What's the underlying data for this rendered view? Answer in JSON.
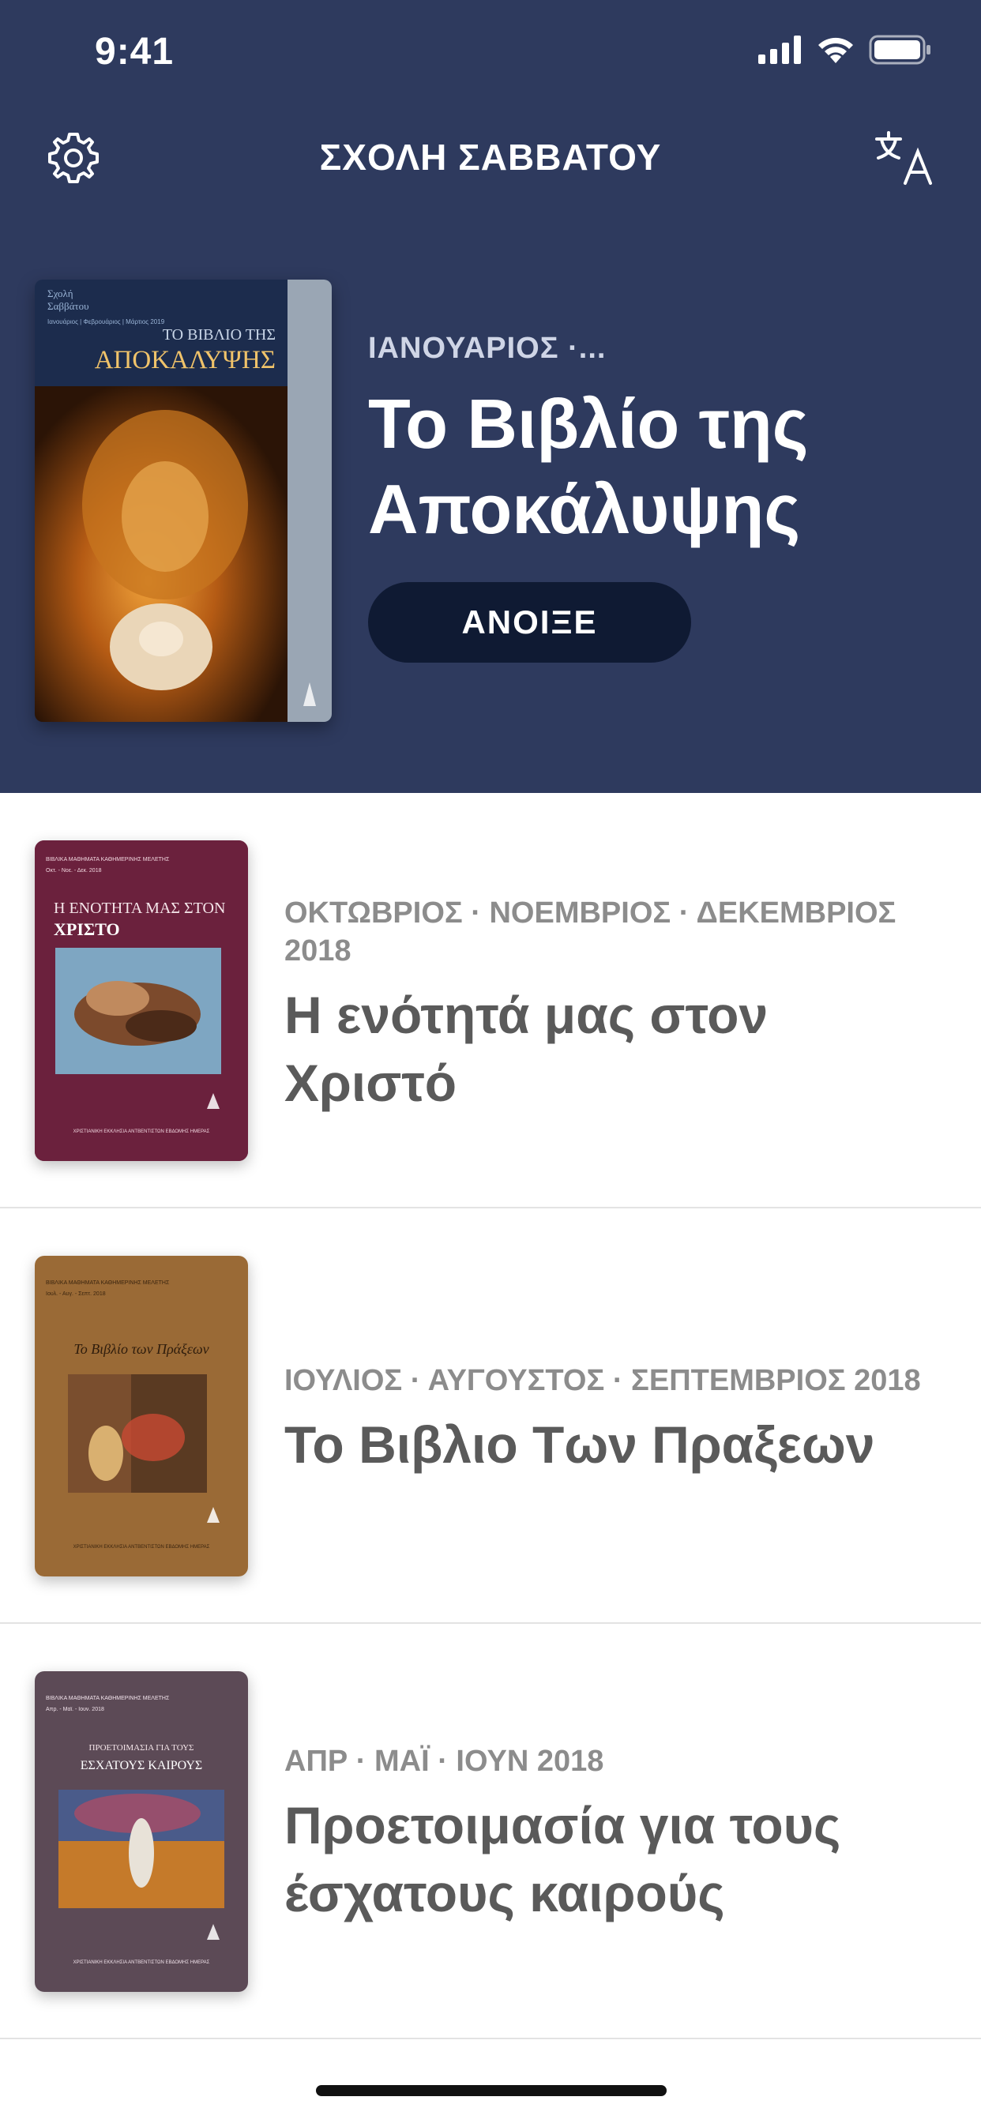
{
  "status": {
    "time": "9:41"
  },
  "nav": {
    "title": "ΣΧΟΛΗ ΣΑΒΒΑΤΟΥ",
    "left_icon": "gear-icon",
    "right_icon": "translate-icon"
  },
  "featured": {
    "date": "ΙΑΝΟΥΑΡΙΟΣ ·...",
    "title_line1": "Το Βιβλίο της",
    "title_line2": "Αποκάλυψης",
    "button_label": "ΑΝΟΙΞΕ",
    "cover": {
      "top_small1": "Σχολή",
      "top_small2": "Σαββάτου",
      "top_small3": "Ιανουάριος | Φεβρουάριος | Μάρτιος 2019",
      "line1": "ΤΟ ΒΙΒΛΙΟ ΤΗΣ",
      "line2": "ΑΠΟΚΑΛΥΨΗΣ"
    }
  },
  "items": [
    {
      "date": "ΟΚΤΩΒΡΙΟΣ · ΝΟΕΜΒΡΙΟΣ · ΔΕΚΕΜΒΡΙΟΣ 2018",
      "title": "Η ενότητά μας στον Χριστό",
      "cover_line1": "Η ΕΝΟΤΗΤΑ ΜΑΣ ΣΤΟΝ",
      "cover_line2": "ΧΡΙΣΤΟ",
      "cover_small": "ΒΙΒΛΙΚΑ ΜΑΘΗΜΑΤΑ ΚΑΘΗΜΕΡΙΝΗΣ ΜΕΛΕΤΗΣ",
      "cover_small2": "Οκτ. - Νοε. - Δεκ. 2018",
      "cover_footer": "ΧΡΙΣΤΙΑΝΙΚΗ ΕΚΚΛΗΣΙΑ ΑΝΤΒΕΝΤΙΣΤΩΝ ΕΒΔΟΜΗΣ ΗΜΕΡΑΣ"
    },
    {
      "date": "ΙΟΥΛΙΟΣ · ΑΥΓΟΥΣΤΟΣ · ΣΕΠΤΕΜΒΡΙΟΣ 2018",
      "title": "Το Βιβλιο Των Πραξεων",
      "cover_line1": "Το Βιβλίο των Πράξεων",
      "cover_small": "ΒΙΒΛΙΚΑ ΜΑΘΗΜΑΤΑ ΚΑΘΗΜΕΡΙΝΗΣ ΜΕΛΕΤΗΣ",
      "cover_small2": "Ιουλ. - Αυγ. - Σεπτ. 2018",
      "cover_footer": "ΧΡΙΣΤΙΑΝΙΚΗ ΕΚΚΛΗΣΙΑ ΑΝΤΒΕΝΤΙΣΤΩΝ ΕΒΔΟΜΗΣ ΗΜΕΡΑΣ"
    },
    {
      "date": "ΑΠΡ · ΜΑΪ · ΙΟΥΝ 2018",
      "title": "Προετοιμασία για τους έσχατους καιρούς",
      "cover_line1": "ΠΡΟΕΤΟΙΜΑΣΙΑ ΓΙΑ ΤΟΥΣ",
      "cover_line2": "ΕΣΧΑΤΟΥΣ ΚΑΙΡΟΥΣ",
      "cover_small": "ΒΙΒΛΙΚΑ ΜΑΘΗΜΑΤΑ ΚΑΘΗΜΕΡΙΝΗΣ ΜΕΛΕΤΗΣ",
      "cover_small2": "Απρ. - Μαϊ. - Ιουν. 2018",
      "cover_footer": "ΧΡΙΣΤΙΑΝΙΚΗ ΕΚΚΛΗΣΙΑ ΑΝΤΒΕΝΤΙΣΤΩΝ ΕΒΔΟΜΗΣ ΗΜΕΡΑΣ"
    }
  ],
  "colors": {
    "header_bg": "#2e3a5e",
    "button_bg": "#0f1a33",
    "date_gray": "#8c8c8c",
    "title_gray": "#5a5a5a"
  }
}
